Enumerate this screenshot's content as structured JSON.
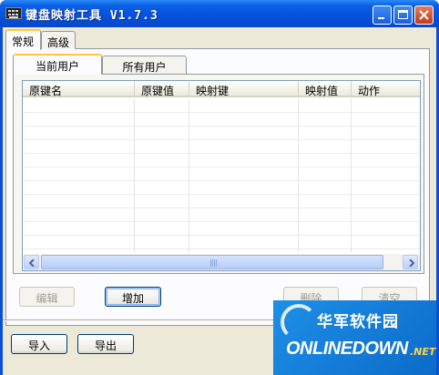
{
  "window": {
    "title": "键盘映射工具 V1.7.3",
    "minimize_icon": "minimize-icon",
    "maximize_icon": "maximize-icon",
    "close_icon": "close-icon"
  },
  "top_tabs": [
    {
      "label": "常规",
      "selected": true
    },
    {
      "label": "高级",
      "selected": false
    }
  ],
  "user_tabs": [
    {
      "label": "当前用户",
      "selected": true
    },
    {
      "label": "所有用户",
      "selected": false
    }
  ],
  "table": {
    "columns": [
      "原键名",
      "原键值",
      "映射键",
      "映射值",
      "动作"
    ],
    "rows": []
  },
  "buttons": {
    "edit": "编辑",
    "add": "增加",
    "delete": "删除",
    "clear": "清空",
    "import": "导入",
    "export": "导出"
  },
  "watermark": {
    "cn": "华军软件园",
    "en": "ONLINEDOWN",
    "suffix": ".NET"
  },
  "colors": {
    "titlebar": "#0551DA",
    "tab_highlight": "#FFC83C",
    "dialog_bg": "#ECE9D8"
  }
}
